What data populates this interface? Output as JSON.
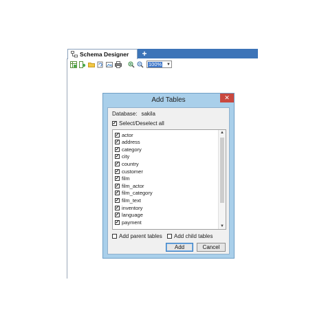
{
  "tabs": {
    "active_label": "Schema Designer",
    "add_label": "+"
  },
  "toolbar": {
    "zoom_value": "100%",
    "icons": [
      "add-table-icon",
      "add-relation-icon",
      "open-folder-icon",
      "refresh-icon",
      "export-image-icon",
      "print-icon",
      "zoom-in-icon",
      "zoom-out-icon"
    ]
  },
  "dialog": {
    "title": "Add Tables",
    "close_label": "✕",
    "database_label": "Database:",
    "database_value": "sakila",
    "select_all_label": "Select/Deselect all",
    "select_all_checked": true,
    "tables": [
      {
        "name": "actor",
        "checked": true
      },
      {
        "name": "address",
        "checked": true
      },
      {
        "name": "category",
        "checked": true
      },
      {
        "name": "city",
        "checked": true
      },
      {
        "name": "country",
        "checked": true
      },
      {
        "name": "customer",
        "checked": true
      },
      {
        "name": "film",
        "checked": true
      },
      {
        "name": "film_actor",
        "checked": true
      },
      {
        "name": "film_category",
        "checked": true
      },
      {
        "name": "film_text",
        "checked": true
      },
      {
        "name": "inventory",
        "checked": true
      },
      {
        "name": "language",
        "checked": true
      },
      {
        "name": "payment",
        "checked": true
      }
    ],
    "add_parent_label": "Add parent tables",
    "add_parent_checked": false,
    "add_child_label": "Add child tables",
    "add_child_checked": false,
    "add_button": "Add",
    "cancel_button": "Cancel"
  },
  "colors": {
    "tab_strip": "#3c74b8",
    "dialog_frame": "#a9cfea",
    "close_button": "#c9483f"
  }
}
